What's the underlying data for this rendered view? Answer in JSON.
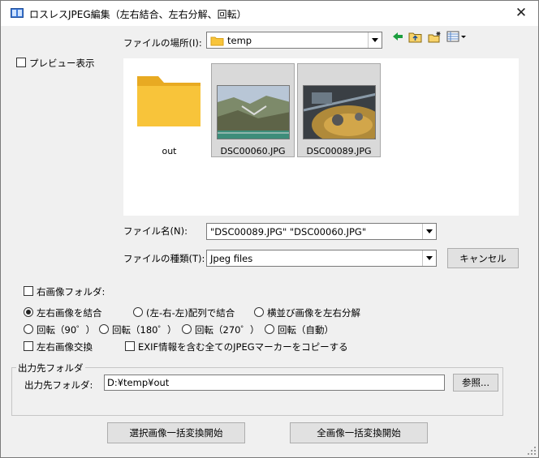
{
  "window": {
    "title": "ロスレスJPEG編集（左右結合、左右分解、回転）",
    "close_glyph": "✕"
  },
  "file_dialog": {
    "location_label": "ファイルの場所(I):",
    "location_value": "temp",
    "preview_label": "プレビュー表示",
    "items": [
      {
        "name": "out",
        "type": "folder",
        "selected": false
      },
      {
        "name": "DSC00060.JPG",
        "type": "image",
        "selected": true
      },
      {
        "name": "DSC00089.JPG",
        "type": "image",
        "selected": true
      }
    ],
    "filename_label": "ファイル名(N):",
    "filename_value": "\"DSC00089.JPG\" \"DSC00060.JPG\"",
    "filetype_label": "ファイルの種類(T):",
    "filetype_value": "Jpeg files",
    "cancel_label": "キャンセル"
  },
  "options": {
    "right_folder_label": "右画像フォルダ:",
    "radio_combine": "左右画像を結合",
    "radio_lrl": "(左-右-左)配列で結合",
    "radio_split": "横並び画像を左右分解",
    "radio_rot90": "回転（90゜）",
    "radio_rot180": "回転（180゜）",
    "radio_rot270": "回転（270゜）",
    "radio_rotauto": "回転（自動）",
    "swap_label": "左右画像交換",
    "exif_label": "EXIF情報を含む全てのJPEGマーカーをコピーする"
  },
  "output": {
    "group_label": "出力先フォルダ",
    "folder_label": "出力先フォルダ:",
    "folder_value": "D:¥temp¥out",
    "browse_label": "参照..."
  },
  "actions": {
    "selected_label": "選択画像一括変換開始",
    "all_label": "全画像一括変換開始"
  },
  "colors": {
    "folder_yellow": "#f8c43a",
    "nav_green": "#1b9e3e"
  }
}
